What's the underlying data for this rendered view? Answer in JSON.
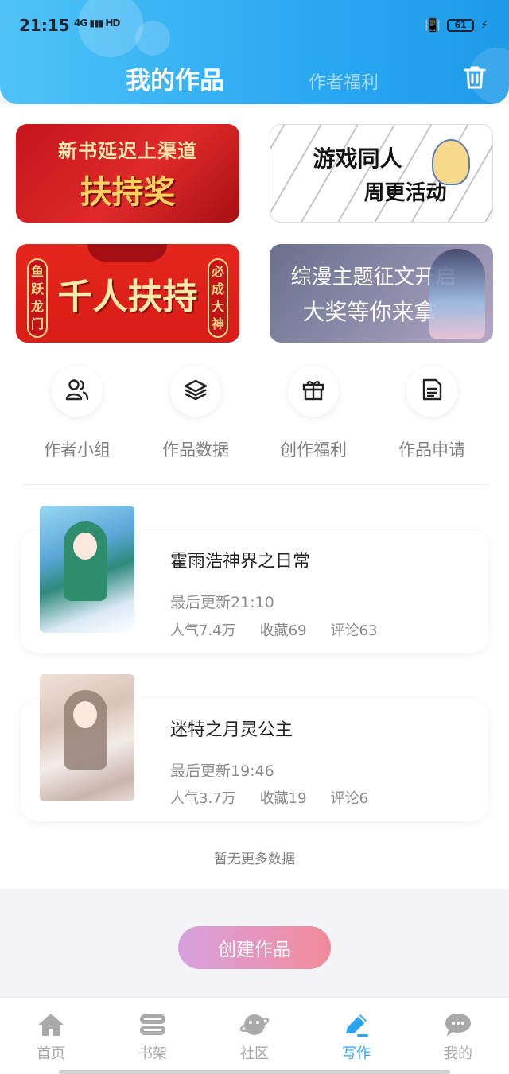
{
  "status_bar": {
    "time": "21:15",
    "network": "4G",
    "hd": "HD",
    "battery": "61"
  },
  "header": {
    "tab_my_works": "我的作品",
    "tab_author_benefits": "作者福利",
    "trash_icon": "trash-icon"
  },
  "banners": [
    {
      "line1": "新书延迟上渠道",
      "line2": "扶持奖"
    },
    {
      "line1": "游戏同人",
      "line2": "周更活动"
    },
    {
      "main": "千人扶持",
      "left_tag": "鱼跃龙门",
      "right_tag": "必成大神"
    },
    {
      "line1": "综漫主题征文开启",
      "line2": "大奖等你来拿"
    }
  ],
  "actions": [
    {
      "label": "作者小组",
      "icon": "users-icon"
    },
    {
      "label": "作品数据",
      "icon": "layers-icon"
    },
    {
      "label": "创作福利",
      "icon": "gift-icon"
    },
    {
      "label": "作品申请",
      "icon": "document-icon"
    }
  ],
  "works": [
    {
      "title": "霍雨浩神界之日常",
      "updated": "最后更新21:10",
      "popularity": "人气7.4万",
      "favorites": "收藏69",
      "comments": "评论63"
    },
    {
      "title": "迷特之月灵公主",
      "updated": "最后更新19:46",
      "popularity": "人气3.7万",
      "favorites": "收藏19",
      "comments": "评论6"
    }
  ],
  "no_more_text": "暂无更多数据",
  "create_button": "创建作品",
  "bottom_nav": [
    {
      "label": "首页",
      "icon": "home-icon"
    },
    {
      "label": "书架",
      "icon": "bookshelf-icon"
    },
    {
      "label": "社区",
      "icon": "planet-icon"
    },
    {
      "label": "写作",
      "icon": "pen-icon",
      "active": true
    },
    {
      "label": "我的",
      "icon": "chat-bubble-icon"
    }
  ],
  "colors": {
    "header_start": "#4fc3f7",
    "header_end": "#1e9be8",
    "active_nav": "#2ba4f0",
    "create_button_start": "#d8a2df",
    "create_button_end": "#f3899b"
  }
}
